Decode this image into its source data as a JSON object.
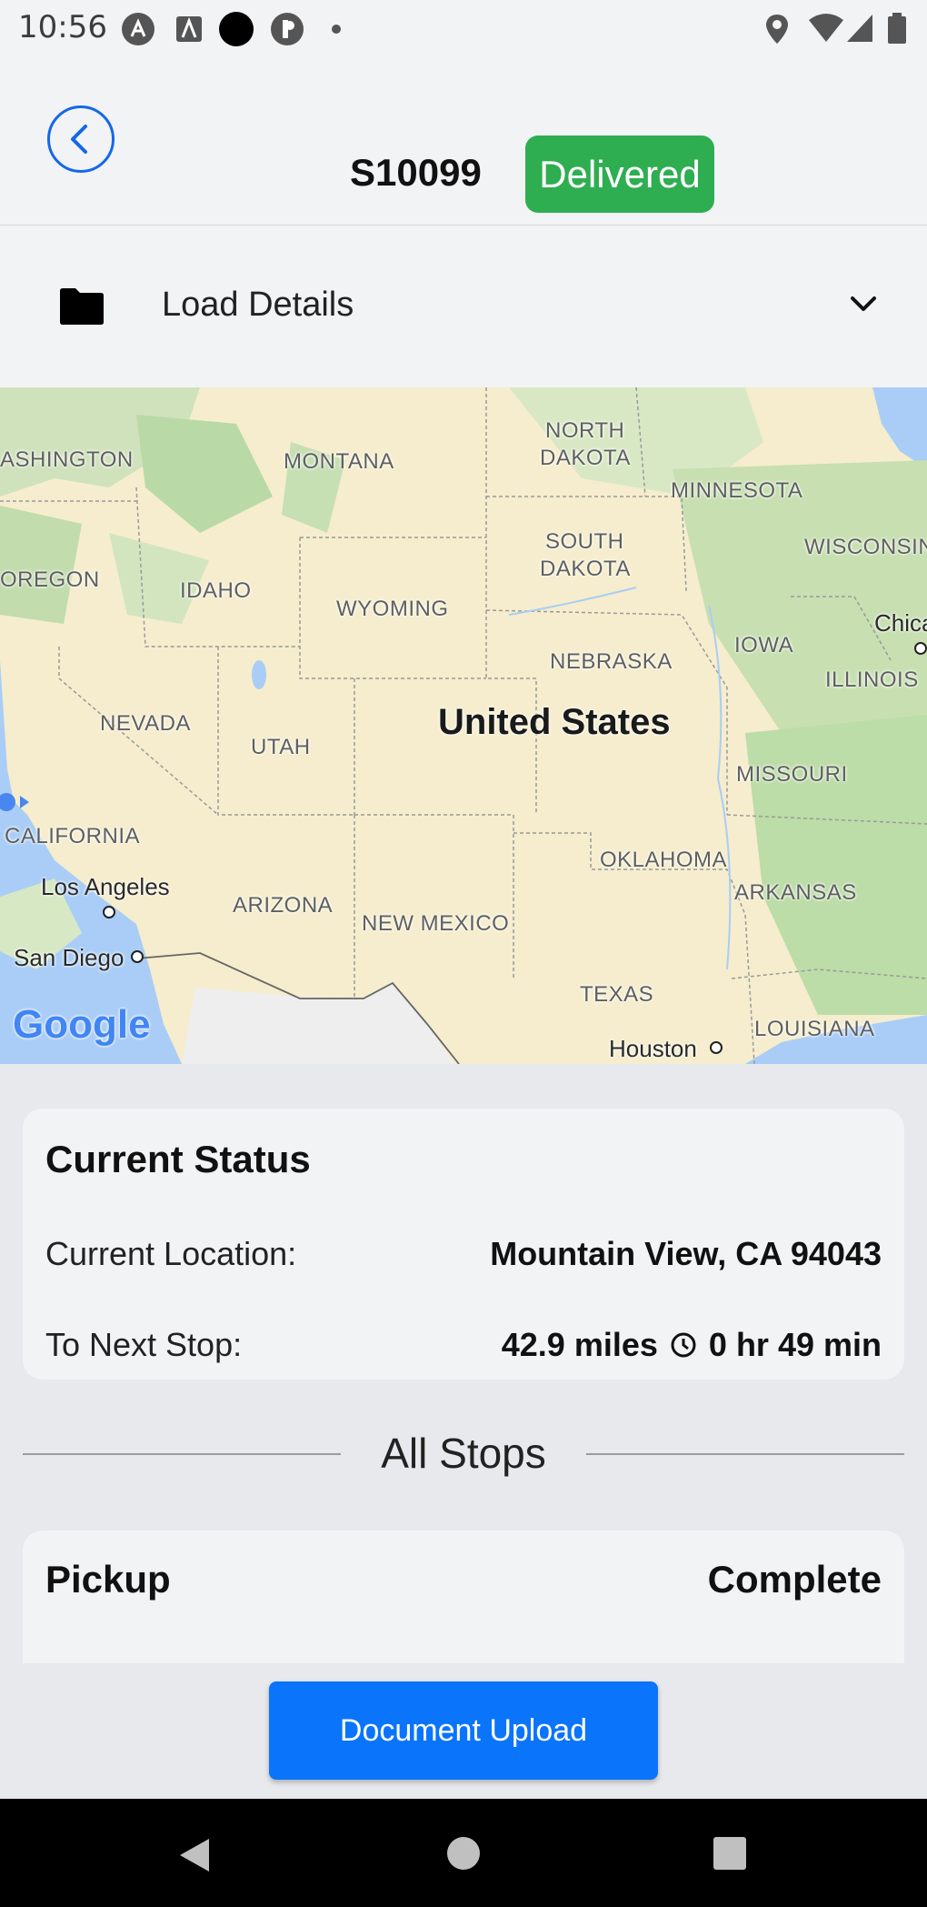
{
  "status_bar": {
    "time": "10:56"
  },
  "header": {
    "order_id": "S10099",
    "status": "Delivered"
  },
  "load_details": {
    "label": "Load Details"
  },
  "map": {
    "country": "United States",
    "labels": {
      "washington": "ASHINGTON",
      "montana": "MONTANA",
      "north_dakota_1": "NORTH",
      "north_dakota_2": "DAKOTA",
      "minnesota": "MINNESOTA",
      "south_dakota_1": "SOUTH",
      "south_dakota_2": "DAKOTA",
      "wisconsin": "WISCONSIN",
      "oregon": "OREGON",
      "idaho": "IDAHO",
      "wyoming": "WYOMING",
      "chicago": "Chica",
      "iowa": "IOWA",
      "nebraska": "NEBRASKA",
      "illinois": "ILLINOIS",
      "nevada": "NEVADA",
      "utah": "UTAH",
      "missouri": "MISSOURI",
      "california": "CALIFORNIA",
      "los_angeles": "Los Angeles",
      "arizona": "ARIZONA",
      "oklahoma": "OKLAHOMA",
      "arkansas": "ARKANSAS",
      "new_mexico": "NEW MEXICO",
      "san_diego": "San Diego",
      "texas": "TEXAS",
      "louisiana": "LOUISIANA",
      "houston": "Houston"
    },
    "attribution": "Google"
  },
  "current_status": {
    "title": "Current Status",
    "location_label": "Current Location:",
    "location_value": "Mountain View, CA 94043",
    "next_stop_label": "To Next Stop:",
    "next_stop_distance": "42.9 miles",
    "next_stop_time": "0 hr 49 min"
  },
  "all_stops": {
    "heading": "All Stops",
    "stops": [
      {
        "type": "Pickup",
        "status": "Complete"
      }
    ]
  },
  "actions": {
    "upload_label": "Document Upload"
  },
  "colors": {
    "accent_blue": "#0a74fb",
    "back_blue": "#1468e8",
    "delivered_green": "#2fae51"
  }
}
